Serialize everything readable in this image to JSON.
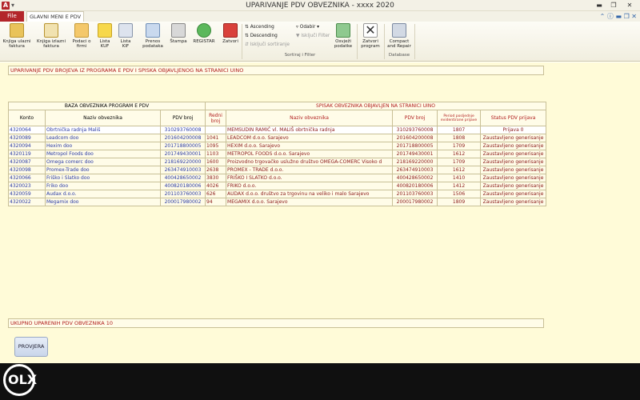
{
  "window": {
    "app_icon": "A",
    "title": "UPARIVANJE PDV OBVEZNIKA - xxxx 2020"
  },
  "tabs": {
    "file": "File",
    "main": "GLAVNI MENI E PDV"
  },
  "ribbon": {
    "buttons": [
      {
        "label": "Knjiga ulazni faktura",
        "icon": "book-in-icon"
      },
      {
        "label": "Knjiga izlazni faktura",
        "icon": "book-out-icon"
      },
      {
        "label": "Podaci o firmi",
        "icon": "company-icon"
      },
      {
        "label": "Lista KUF",
        "icon": "pencil-icon"
      },
      {
        "label": "Lista KIF",
        "icon": "document-icon"
      },
      {
        "label": "Prenos podataka",
        "icon": "transfer-icon"
      },
      {
        "label": "Štampa",
        "icon": "printer-icon"
      },
      {
        "label": "REGISTAR",
        "icon": "refresh-icon"
      },
      {
        "label": "Zatvori",
        "icon": "close-icon"
      }
    ],
    "sort": {
      "ascending": "Ascending",
      "descending": "Descending",
      "remove_sort": "Isključi sortiranje",
      "select": "Odabir",
      "filter": "Isključi Filter",
      "group_label": "Sortiraj i Filter"
    },
    "buttons2": [
      {
        "label": "Osvježi podatke",
        "icon": "refresh-data-icon"
      },
      {
        "label": "Zatvori program",
        "icon": "x-icon"
      },
      {
        "label": "Compact and Repair",
        "icon": "tools-icon"
      }
    ],
    "database_label": "Database"
  },
  "header_title": "UPARIVANJE PDV BROJEVA IZ PROGRAMA E PDV I SPISKA OBJAVLJENOG NA STRANICI UINO",
  "table": {
    "group_left": "BAZA OBVEZNIKA PROGRAM E PDV",
    "group_right": "SPISAK OBVEZNIKA OBJAVLJEN NA STRANICI UINO",
    "columns": {
      "konto": "Konto",
      "naziv": "Naziv obveznika",
      "pdv": "PDV broj",
      "redni": "Redni broj",
      "naziv2": "Naziv obveznika",
      "pdv2": "PDV broj",
      "period": "Period posljednje evidentirane prijave",
      "status": "Status PDV prijava"
    },
    "rows": [
      {
        "konto": "4320064",
        "naziv": "Obrtnička radnja Mališ",
        "pdv": "310293760008",
        "redni": "",
        "naziv2": "MEMSUDIN RAMIĆ vl. MALIŠ obrtnička radnja",
        "pdv2": "310293760008",
        "period": "1807",
        "status": "Prijava 0"
      },
      {
        "konto": "4320089",
        "naziv": "Leadcom doo",
        "pdv": "201604200008",
        "redni": "1041",
        "naziv2": "LEADCOM d.o.o. Sarajevo",
        "pdv2": "201604200008",
        "period": "1808",
        "status": "Zaustavljeno generisanje"
      },
      {
        "konto": "4320094",
        "naziv": "Hexim doo",
        "pdv": "201718800005",
        "redni": "1095",
        "naziv2": "HEXIM d.o.o. Sarajevo",
        "pdv2": "201718800005",
        "period": "1709",
        "status": "Zaustavljeno generisanje"
      },
      {
        "konto": "4320119",
        "naziv": "Metropol Foods doo",
        "pdv": "201749430001",
        "redni": "1103",
        "naziv2": "METROPOL FOODS d.o.o. Sarajevo",
        "pdv2": "201749430001",
        "period": "1612",
        "status": "Zaustavljeno generisanje"
      },
      {
        "konto": "4320087",
        "naziv": "Omega comerc doo",
        "pdv": "218169220000",
        "redni": "1600",
        "naziv2": "Proizvodno trgovačko uslužno društvo OMEGA-COMERC Visoko d",
        "pdv2": "218169220000",
        "period": "1709",
        "status": "Zaustavljeno generisanje"
      },
      {
        "konto": "4320098",
        "naziv": "Promex-Trade doo",
        "pdv": "263474910003",
        "redni": "2638",
        "naziv2": "PROMEX - TRADE d.o.o.",
        "pdv2": "263474910003",
        "period": "1612",
        "status": "Zaustavljeno generisanje"
      },
      {
        "konto": "4320066",
        "naziv": "Friško i Slatko doo",
        "pdv": "400428650002",
        "redni": "3830",
        "naziv2": "FRIŠKO I SLATKO d.o.o.",
        "pdv2": "400428650002",
        "period": "1410",
        "status": "Zaustavljeno generisanje"
      },
      {
        "konto": "4320023",
        "naziv": "Friko doo",
        "pdv": "400820180006",
        "redni": "4026",
        "naziv2": "FRIKO d.o.o.",
        "pdv2": "400820180006",
        "period": "1412",
        "status": "Zaustavljeno generisanje"
      },
      {
        "konto": "4320059",
        "naziv": "Audax d.o.o.",
        "pdv": "201103760003",
        "redni": "626",
        "naziv2": "AUDAX d.o.o. društvo za trgovinu na veliko i malo Sarajevo",
        "pdv2": "201103760003",
        "period": "1506",
        "status": "Zaustavljeno generisanje"
      },
      {
        "konto": "4320022",
        "naziv": "Megamix doo",
        "pdv": "200017980002",
        "redni": "94",
        "naziv2": "MEGAMIX d.o.o. Sarajevo",
        "pdv2": "200017980002",
        "period": "1809",
        "status": "Zaustavljeno generisanje"
      }
    ]
  },
  "footer_text": "UKUPNO UPARENIH PDV OBVEZNIKA 10",
  "provjera_button": "PROVJERA",
  "watermark": "OLX"
}
